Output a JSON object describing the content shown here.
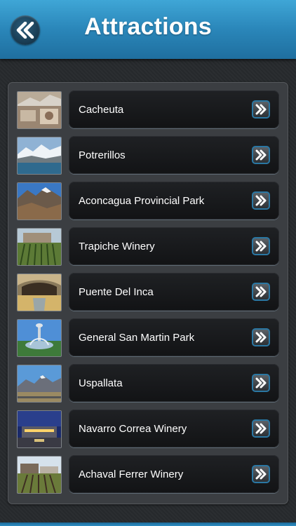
{
  "header": {
    "title": "Attractions",
    "back_icon": "double-chevron-left-icon",
    "color": "#2a86b9"
  },
  "items": [
    {
      "label": "Cacheuta",
      "thumb": "cacheuta"
    },
    {
      "label": "Potrerillos",
      "thumb": "potrerillos"
    },
    {
      "label": "Aconcagua Provincial Park",
      "thumb": "aconcagua"
    },
    {
      "label": "Trapiche Winery",
      "thumb": "trapiche"
    },
    {
      "label": "Puente Del Inca",
      "thumb": "puente"
    },
    {
      "label": "General San Martin Park",
      "thumb": "sanmartin"
    },
    {
      "label": "Uspallata",
      "thumb": "uspallata"
    },
    {
      "label": "Navarro Correa Winery",
      "thumb": "navarro"
    },
    {
      "label": "Achaval Ferrer Winery",
      "thumb": "achaval"
    }
  ],
  "item_action_icon": "double-chevron-right-icon"
}
